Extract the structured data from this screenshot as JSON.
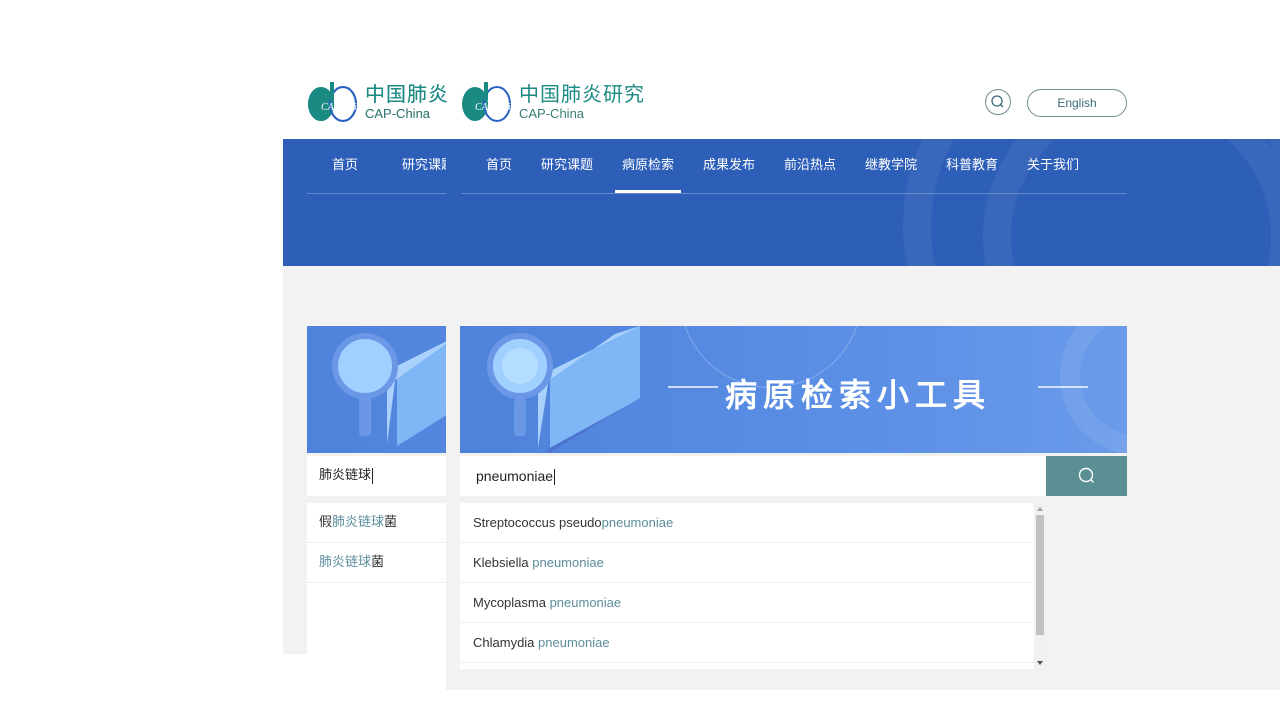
{
  "brand": {
    "short_cn": "中国肺炎",
    "full_cn": "中国肺炎研究",
    "en": "CAP-China",
    "mark_text": "CAP China"
  },
  "header": {
    "language_button": "English",
    "search_icon": "search-icon"
  },
  "nav": {
    "items": [
      "首页",
      "研究课题",
      "病原检索",
      "成果发布",
      "前沿热点",
      "继教学院",
      "科普教育",
      "关于我们"
    ],
    "active_index": 2
  },
  "tool": {
    "title": "病原检索小工具",
    "search_value": "pneumoniae",
    "search_icon": "search-icon",
    "suggestions": [
      {
        "prefix": "Streptococcus pseudo",
        "match": "pneumoniae"
      },
      {
        "prefix": "Klebsiella ",
        "match": "pneumoniae"
      },
      {
        "prefix": "Mycoplasma ",
        "match": "pneumoniae"
      },
      {
        "prefix": "Chlamydia ",
        "match": "pneumoniae"
      }
    ]
  },
  "left_panel": {
    "nav_items": [
      "首页",
      "研究课题"
    ],
    "search_value": "肺炎链球",
    "suggestions": [
      {
        "prefix": "假",
        "match": "肺炎链球",
        "suffix": "菌"
      },
      {
        "prefix": "",
        "match": "肺炎链球",
        "suffix": "菌"
      }
    ]
  },
  "colors": {
    "brand_green": "#1b8a83",
    "nav_blue": "#2e5fb8",
    "highlight": "#5b8d9c",
    "search_button": "#5a8f93"
  }
}
